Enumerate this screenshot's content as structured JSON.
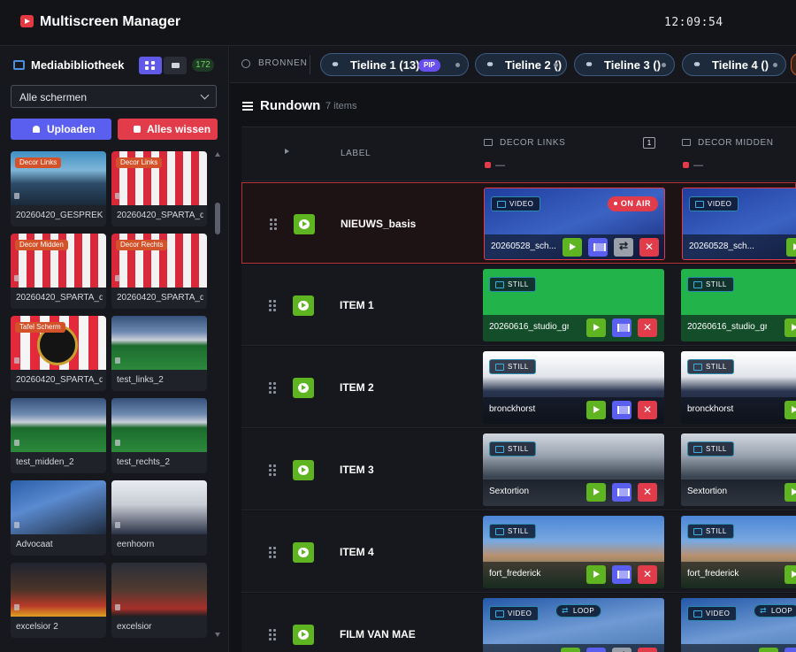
{
  "header": {
    "title": "Multiscreen Manager",
    "clock": "12:09:54"
  },
  "sidebar": {
    "title": "Mediabibliotheek",
    "count": "172",
    "filter_value": "Alle schermen",
    "upload_label": "Uploaden",
    "clear_label": "Alles wissen",
    "media": [
      {
        "name": "20260420_GESPREK_...",
        "tag": "Decor Links",
        "thumb": "city"
      },
      {
        "name": "20260420_SPARTA_d...",
        "tag": "Decor Links",
        "thumb": "stripes"
      },
      {
        "name": "20260420_SPARTA_d...",
        "tag": "Decor Midden",
        "thumb": "stripes"
      },
      {
        "name": "20260420_SPARTA_d...",
        "tag": "Decor Rechts",
        "thumb": "stripes"
      },
      {
        "name": "20260420_SPARTA_d...",
        "tag": "Tafel Scherm",
        "thumb": "crest"
      },
      {
        "name": "test_links_2",
        "tag": "",
        "thumb": "stadium"
      },
      {
        "name": "test_midden_2",
        "tag": "",
        "thumb": "stadium"
      },
      {
        "name": "test_rechts_2",
        "tag": "",
        "thumb": "stadium"
      },
      {
        "name": "Advocaat",
        "tag": "",
        "thumb": "press"
      },
      {
        "name": "eenhoorn",
        "tag": "",
        "thumb": "press2"
      },
      {
        "name": "excelsior 2",
        "tag": "",
        "thumb": "team"
      },
      {
        "name": "excelsior",
        "tag": "",
        "thumb": "team2"
      }
    ]
  },
  "sources": {
    "label": "BRONNEN",
    "timelines": [
      {
        "label": "Tieline 1 (13)",
        "badge": "PIP"
      },
      {
        "label": "Tieline 2 ()",
        "badge": ""
      },
      {
        "label": "Tieline 3 ()",
        "badge": ""
      },
      {
        "label": "Tieline 4 ()",
        "badge": ""
      }
    ]
  },
  "rundown": {
    "title": "Rundown",
    "count": "7 items",
    "label_header": "LABEL",
    "columns": [
      {
        "name": "DECOR LINKS",
        "sub": "—",
        "num": "1"
      },
      {
        "name": "DECOR MIDDEN",
        "sub": "—",
        "num": ""
      }
    ],
    "rows": [
      {
        "label": "NIEUWS_basis",
        "on_air": true,
        "cells": [
          {
            "type": "VIDEO",
            "name": "20260528_sch...",
            "bg": "blue",
            "on_air_label": "ON AIR",
            "loop": true
          },
          {
            "type": "VIDEO",
            "name": "20260528_sch...",
            "bg": "blue",
            "on_air_label": "",
            "loop": false
          }
        ]
      },
      {
        "label": "ITEM 1",
        "on_air": false,
        "cells": [
          {
            "type": "STILL",
            "name": "20260616_studio_gre...",
            "bg": "green",
            "on_air_label": "",
            "loop": false
          },
          {
            "type": "STILL",
            "name": "20260616_studio_gre...",
            "bg": "green",
            "on_air_label": "",
            "loop": false
          }
        ]
      },
      {
        "label": "ITEM 2",
        "on_air": false,
        "cells": [
          {
            "type": "STILL",
            "name": "bronckhorst",
            "bg": "press",
            "on_air_label": "",
            "loop": false
          },
          {
            "type": "STILL",
            "name": "bronckhorst",
            "bg": "press",
            "on_air_label": "",
            "loop": false
          }
        ]
      },
      {
        "label": "ITEM 3",
        "on_air": false,
        "cells": [
          {
            "type": "STILL",
            "name": "Sextortion",
            "bg": "van",
            "on_air_label": "",
            "loop": false
          },
          {
            "type": "STILL",
            "name": "Sextortion",
            "bg": "van",
            "on_air_label": "",
            "loop": false
          }
        ]
      },
      {
        "label": "ITEM 4",
        "on_air": false,
        "cells": [
          {
            "type": "STILL",
            "name": "fort_frederick",
            "bg": "fort",
            "on_air_label": "",
            "loop": false
          },
          {
            "type": "STILL",
            "name": "fort_frederick",
            "bg": "fort",
            "on_air_label": "",
            "loop": false
          }
        ]
      },
      {
        "label": "FILM VAN MAE",
        "on_air": false,
        "cells": [
          {
            "type": "VIDEO",
            "name": "20260715_M...",
            "bg": "city2",
            "on_air_label": "",
            "loop_label": "LOOP",
            "loop": true
          },
          {
            "type": "VIDEO",
            "name": "20260715_M...",
            "bg": "city2",
            "on_air_label": "",
            "loop_label": "LOOP",
            "loop": true
          }
        ]
      }
    ]
  },
  "colors": {
    "accent": "#5b5ff0",
    "danger": "#e23b4a",
    "success": "#5fb521"
  }
}
